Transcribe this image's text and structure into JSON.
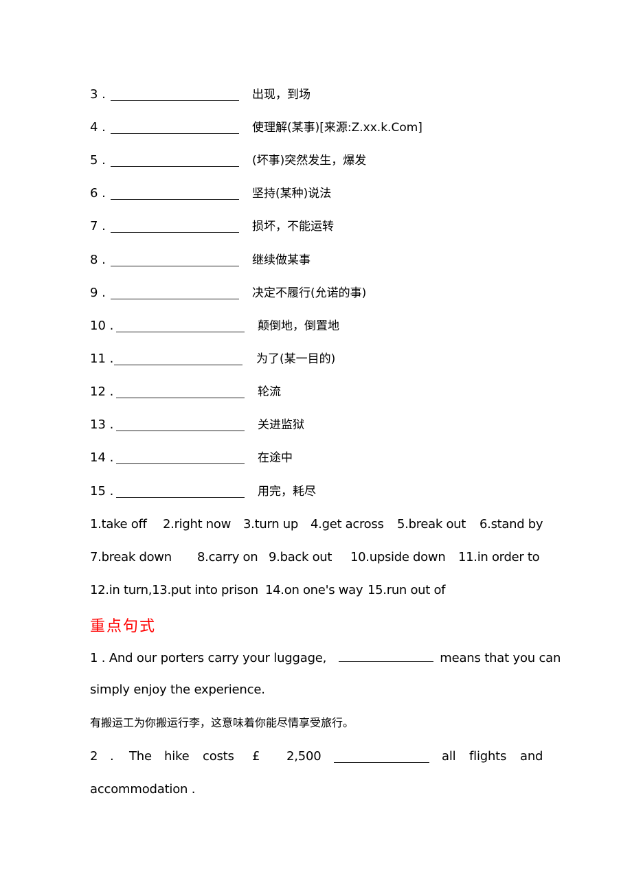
{
  "vocab_items": [
    {
      "num": "3 .",
      "meaning": "出现，到场"
    },
    {
      "num": "4 .",
      "meaning": "使理解(某事)[来源:Z.xx.k.Com]"
    },
    {
      "num": "5 .",
      "meaning": "(坏事)突然发生，爆发"
    },
    {
      "num": "6 .",
      "meaning": "坚持(某种)说法"
    },
    {
      "num": "7 .",
      "meaning": "损坏，不能运转"
    },
    {
      "num": "8 .",
      "meaning": "继续做某事"
    },
    {
      "num": "9 .",
      "meaning": "决定不履行(允诺的事)"
    },
    {
      "num": "10 .",
      "meaning": "颠倒地，倒置地"
    },
    {
      "num": "11 .",
      "meaning": "为了(某一目的)"
    },
    {
      "num": "12 .",
      "meaning": "轮流"
    },
    {
      "num": "13 .",
      "meaning": "关进监狱"
    },
    {
      "num": "14 .",
      "meaning": "在途中"
    },
    {
      "num": "15 .",
      "meaning": "用完，耗尽"
    }
  ],
  "answers": {
    "line1": [
      "1.take off",
      "2.right now",
      "3.turn up",
      "4.get across",
      "5.break out",
      "6.stand by"
    ],
    "line2": [
      "7.break down",
      "8.carry on",
      "9.back out",
      "10.upside down",
      "11.in order to"
    ],
    "line3": [
      "12.in turn,13.put into prison",
      "14.on one's way",
      "15.run out of"
    ]
  },
  "section_heading": "重点句式",
  "heading_color": "#ff0000",
  "sentences": {
    "s1_part1": "1 . And our porters carry your luggage,",
    "s1_part2": "means that you can",
    "s1_line2": "simply enjoy the experience.",
    "s1_translation": "有搬运工为你搬运行李，这意味着你能尽情享受旅行。",
    "s2_num": "2",
    "s2_dot": ".",
    "s2_words": [
      "The",
      "hike",
      "costs",
      "£",
      "2,500"
    ],
    "s2_after": [
      "all",
      "flights",
      "and"
    ],
    "s2_line2": "accommodation ."
  }
}
